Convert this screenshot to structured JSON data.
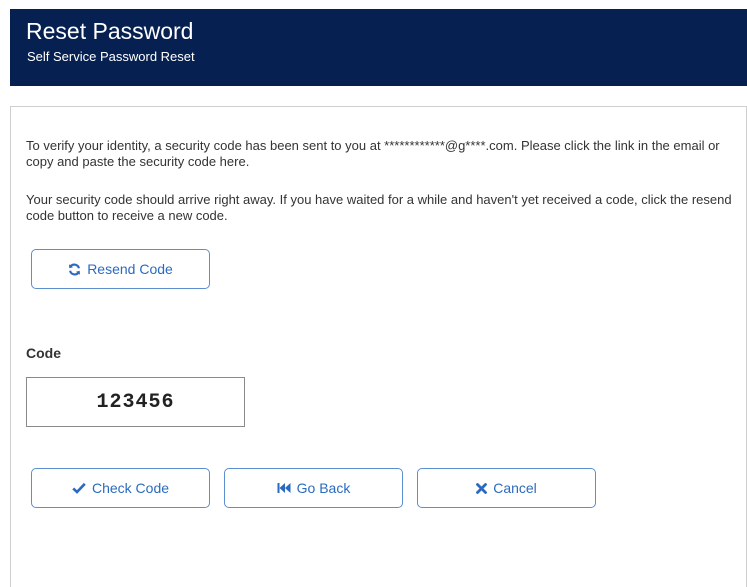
{
  "header": {
    "title": "Reset Password",
    "subtitle": "Self Service Password Reset"
  },
  "content": {
    "verify_text": "To verify your identity, a security code has been sent to you at ************@g****.com. Please click the link in the email or copy and paste the security code here.",
    "arrival_text": "Your security code should arrive right away. If you have waited for a while and haven't yet received a code, click the resend code button to receive a new code."
  },
  "buttons": {
    "resend": "Resend Code",
    "check": "Check Code",
    "back": "Go Back",
    "cancel": "Cancel"
  },
  "code_field": {
    "label": "Code",
    "value": "123456"
  },
  "icons": {
    "resend": "refresh-icon",
    "check": "checkmark-icon",
    "back": "fast-backward-icon",
    "cancel": "close-icon"
  },
  "colors": {
    "header_bg": "#062151",
    "button_text": "#2a6bbf",
    "button_border": "#5b8fd0"
  }
}
